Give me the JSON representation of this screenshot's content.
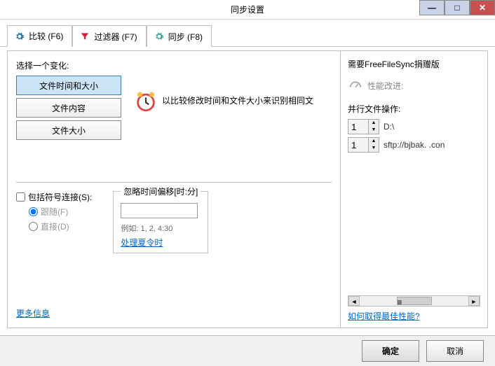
{
  "window": {
    "title": "同步设置"
  },
  "tabs": {
    "compare": "比较 (F6)",
    "filter": "过滤器 (F7)",
    "sync": "同步 (F8)"
  },
  "left": {
    "choose_label": "选择一个变化:",
    "opt_time_size": "文件时间和大小",
    "opt_content": "文件内容",
    "opt_size": "文件大小",
    "desc": "以比较修改时间和文件大小来识别相同文",
    "include_symlinks": "包括符号连接(S):",
    "follow": "跟随(F)",
    "direct": "直接(D)",
    "offset_legend": "忽略时间偏移[时:分]",
    "offset_example": "例如: 1, 2, 4:30",
    "process_dst": "处理夏令时",
    "more_info": "更多信息"
  },
  "right": {
    "title": "需要FreeFileSync捐赠版",
    "perf_label": "性能改进:",
    "parallel_label": "并行文件操作:",
    "rows": [
      {
        "count": "1",
        "path": "D:\\"
      },
      {
        "count": "1",
        "path": "sftp://bjbak.            .con"
      }
    ],
    "best_perf": "如何取得最佳性能?"
  },
  "footer": {
    "ok": "确定",
    "cancel": "取消"
  }
}
